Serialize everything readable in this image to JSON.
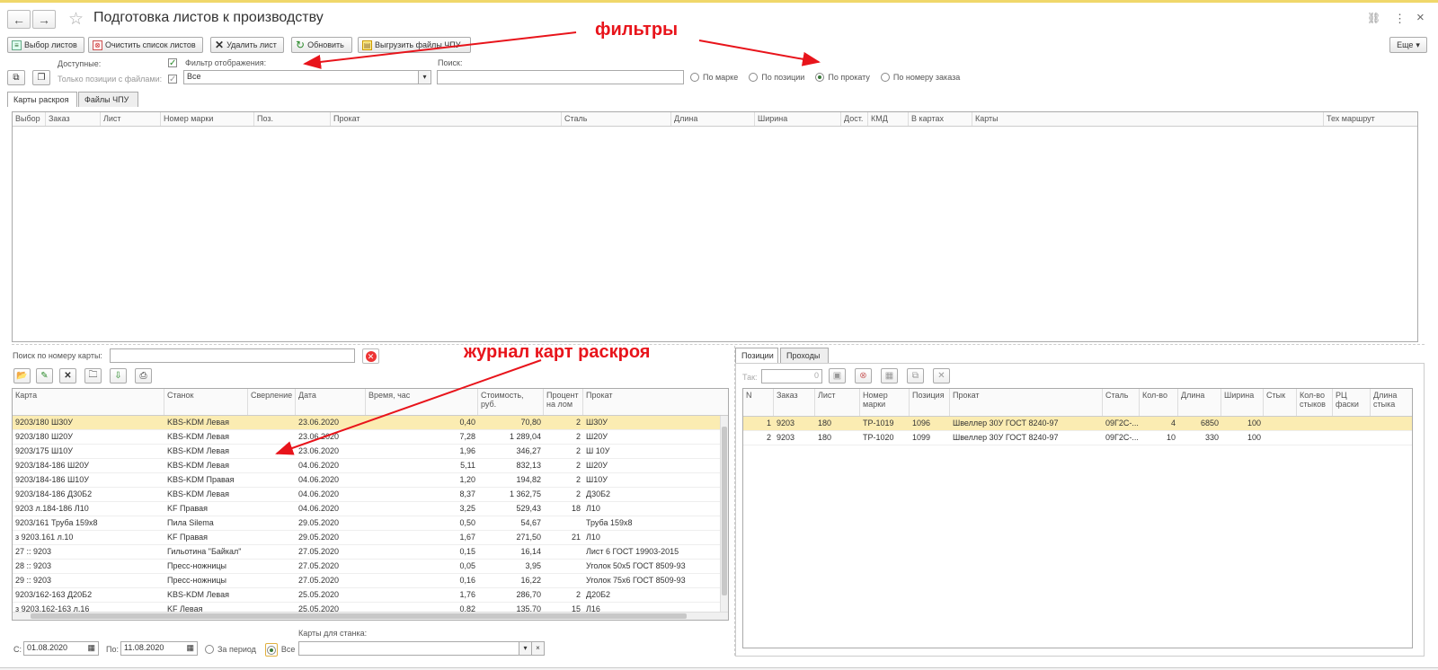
{
  "window": {
    "title": "Подготовка листов к производству",
    "nav_back": "←",
    "nav_forward": "→",
    "star": "☆",
    "link_icon": "🔗",
    "more_icon": "⋮",
    "close_icon": "×"
  },
  "toolbar": {
    "select_sheets": "Выбор листов",
    "clear_list": "Очистить список листов",
    "delete_sheet": "Удалить лист",
    "refresh": "Обновить",
    "export_cnc": "Выгрузить файлы ЧПУ",
    "more": "Еще"
  },
  "filters": {
    "available_label": "Доступные:",
    "only_with_files_label": "Только позиции с файлами:",
    "display_filter_label": "Фильтр отображения:",
    "display_filter_value": "Все",
    "search_label": "Поиск:",
    "search_value": "",
    "radio_mark": "По марке",
    "radio_position": "По позиции",
    "radio_rolled": "По прокату",
    "radio_order": "По номеру заказа",
    "selected_radio": "По прокату"
  },
  "top_tabs": [
    "Карты раскроя",
    "Файлы ЧПУ"
  ],
  "top_grid": {
    "columns": [
      "Выбор",
      "Заказ",
      "Лист",
      "Номер марки",
      "Поз.",
      "Прокат",
      "Сталь",
      "Длина",
      "Ширина",
      "Дост.",
      "КМД",
      "В картах",
      "Карты",
      "Тех маршрут"
    ]
  },
  "card_journal": {
    "search_label": "Поиск по номеру карты:",
    "search_value": "",
    "columns": [
      "Карта",
      "Станок",
      "Сверление",
      "Дата",
      "Время, час",
      "Стоимость, руб.",
      "Процент на лом",
      "Прокат"
    ],
    "rows": [
      [
        "9203/180 Ш30У",
        "KBS-KDM Левая",
        "",
        "23.06.2020",
        "0,40",
        "70,80",
        "2",
        "Ш30У"
      ],
      [
        "9203/180 Ш20У",
        "KBS-KDM Левая",
        "",
        "23.06.2020",
        "7,28",
        "1 289,04",
        "2",
        "Ш20У"
      ],
      [
        "9203/175 Ш10У",
        "KBS-KDM Левая",
        "",
        "23.06.2020",
        "1,96",
        "346,27",
        "2",
        "Ш 10У"
      ],
      [
        "9203/184-186 Ш20У",
        "KBS-KDM Левая",
        "",
        "04.06.2020",
        "5,11",
        "832,13",
        "2",
        "Ш20У"
      ],
      [
        "9203/184-186 Ш10У",
        "KBS-KDM Правая",
        "",
        "04.06.2020",
        "1,20",
        "194,82",
        "2",
        "Ш10У"
      ],
      [
        "9203/184-186 Д30Б2",
        "KBS-KDM Левая",
        "",
        "04.06.2020",
        "8,37",
        "1 362,75",
        "2",
        "Д30Б2"
      ],
      [
        "9203 л.184-186 Л10",
        "KF Правая",
        "",
        "04.06.2020",
        "3,25",
        "529,43",
        "18",
        "Л10"
      ],
      [
        "9203/161 Труба 159х8",
        "Пила Silema",
        "",
        "29.05.2020",
        "0,50",
        "54,67",
        "",
        "Труба 159х8"
      ],
      [
        "з 9203.161 л.10",
        "KF Правая",
        "",
        "29.05.2020",
        "1,67",
        "271,50",
        "21",
        "Л10"
      ],
      [
        "27 :: 9203",
        "Гильотина \"Байкал\"",
        "",
        "27.05.2020",
        "0,15",
        "16,14",
        "",
        "Лист 6 ГОСТ 19903-2015"
      ],
      [
        "28 :: 9203",
        "Пресс-ножницы",
        "",
        "27.05.2020",
        "0,05",
        "3,95",
        "",
        "Уголок 50х5 ГОСТ 8509-93"
      ],
      [
        "29 :: 9203",
        "Пресс-ножницы",
        "",
        "27.05.2020",
        "0,16",
        "16,22",
        "",
        "Уголок 75х6 ГОСТ 8509-93"
      ],
      [
        "9203/162-163 Д20Б2",
        "KBS-KDM Левая",
        "",
        "25.05.2020",
        "1,76",
        "286,70",
        "2",
        "Д20Б2"
      ],
      [
        "з 9203.162-163 л.16",
        "KF Левая",
        "",
        "25.05.2020",
        "0,82",
        "135,70",
        "15",
        "Л16"
      ]
    ]
  },
  "period": {
    "from_label": "С:",
    "from_value": "01.08.2020",
    "to_label": "По:",
    "to_value": "11.08.2020",
    "radio_period": "За период",
    "radio_all": "Все",
    "machine_label": "Карты для станка:",
    "machine_value": ""
  },
  "right_tabs": [
    "Позиции",
    "Проходы"
  ],
  "positions": {
    "tak_label": "Так:",
    "tak_value": "0",
    "columns": [
      "N",
      "Заказ",
      "Лист",
      "Номер марки",
      "Позиция",
      "Прокат",
      "Сталь",
      "Кол-во",
      "Длина",
      "Ширина",
      "Стык",
      "Кол-во стыков",
      "РЦ фаски",
      "Длина стыка"
    ],
    "rows": [
      [
        "1",
        "9203",
        "180",
        "ТР-1019",
        "1096",
        "Швеллер 30У ГОСТ 8240-97",
        "09Г2С-...",
        "4",
        "6850",
        "100",
        "",
        "",
        "",
        ""
      ],
      [
        "2",
        "9203",
        "180",
        "ТР-1020",
        "1099",
        "Швеллер 30У ГОСТ 8240-97",
        "09Г2С-...",
        "10",
        "330",
        "100",
        "",
        "",
        "",
        ""
      ]
    ]
  },
  "annotations": {
    "filters": "фильтры",
    "journal": "журнал карт раскроя"
  },
  "colors": {
    "annotation": "#e8141b",
    "selected_row": "#fbecb2",
    "top_border": "#f0d76a"
  }
}
